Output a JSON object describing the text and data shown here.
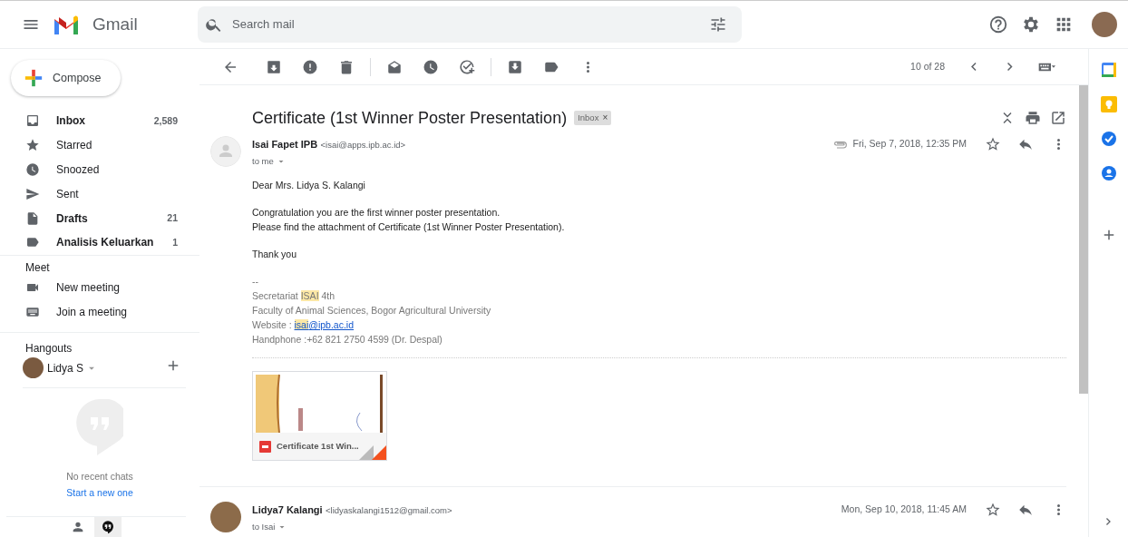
{
  "header": {
    "app_name": "Gmail",
    "search": {
      "placeholder": "Search mail"
    }
  },
  "compose": {
    "label": "Compose"
  },
  "folders": [
    {
      "label": "Inbox",
      "count": "2,589",
      "unread": true
    },
    {
      "label": "Starred",
      "unread": false
    },
    {
      "label": "Snoozed",
      "unread": false
    },
    {
      "label": "Sent",
      "unread": false
    },
    {
      "label": "Drafts",
      "count": "21",
      "unread": true
    },
    {
      "label": "Analisis Keluarkan",
      "count": "1",
      "unread": true
    }
  ],
  "meet": {
    "title": "Meet",
    "items": [
      {
        "label": "New meeting"
      },
      {
        "label": "Join a meeting"
      }
    ]
  },
  "hangouts": {
    "title": "Hangouts",
    "user": "Lidya S",
    "empty_text": "No recent chats",
    "link": "Start a new one"
  },
  "toolbar": {
    "pager": "10 of 28"
  },
  "thread": {
    "subject": "Certificate (1st Winner Poster Presentation)",
    "label": "Inbox",
    "remove_symbol": "×"
  },
  "messages": [
    {
      "sender": "Isai Fapet IPB",
      "email": "<isai@apps.ipb.ac.id>",
      "recipient": "to me",
      "date": "Fri, Sep 7, 2018, 12:35 PM",
      "has_attachment": true,
      "paragraphs": [
        {
          "kind": "body",
          "lines": [
            [
              {
                "kind": "plain",
                "text": "Dear Mrs. Lidya S. Kalangi"
              }
            ]
          ]
        },
        {
          "kind": "body",
          "lines": [
            [
              {
                "kind": "plain",
                "text": "Congratulation you are the first winner poster presentation."
              }
            ],
            [
              {
                "kind": "plain",
                "text": "Please find the attachment of Certificate (1st Winner Poster Presentation)."
              }
            ]
          ]
        },
        {
          "kind": "body",
          "lines": [
            [
              {
                "kind": "plain",
                "text": "Thank you"
              }
            ]
          ]
        },
        {
          "kind": "signature",
          "lines": [
            [
              {
                "kind": "plain",
                "text": "--"
              }
            ],
            [
              {
                "kind": "plain",
                "text": "Secretariat "
              },
              {
                "kind": "highlight",
                "text": "ISAI"
              },
              {
                "kind": "plain",
                "text": " 4th"
              }
            ],
            [
              {
                "kind": "plain",
                "text": "Faculty of Animal Sciences, Bogor Agricultural University"
              }
            ],
            [
              {
                "kind": "plain",
                "text": "Website : "
              },
              {
                "kind": "link_highlight",
                "text": "isai"
              },
              {
                "kind": "link",
                "text": "@ipb.ac.id"
              }
            ],
            [
              {
                "kind": "plain",
                "text": "Handphone :+62 821 2750 4599 (Dr. Despal)"
              }
            ]
          ]
        }
      ],
      "attachment": {
        "name": "Certificate 1st Win..."
      }
    },
    {
      "sender": "Lidya7 Kalangi",
      "email": "<lidyaskalangi1512@gmail.com>",
      "recipient": "to Isai",
      "date": "Mon, Sep 10, 2018, 11:45 AM",
      "has_attachment": false
    }
  ]
}
